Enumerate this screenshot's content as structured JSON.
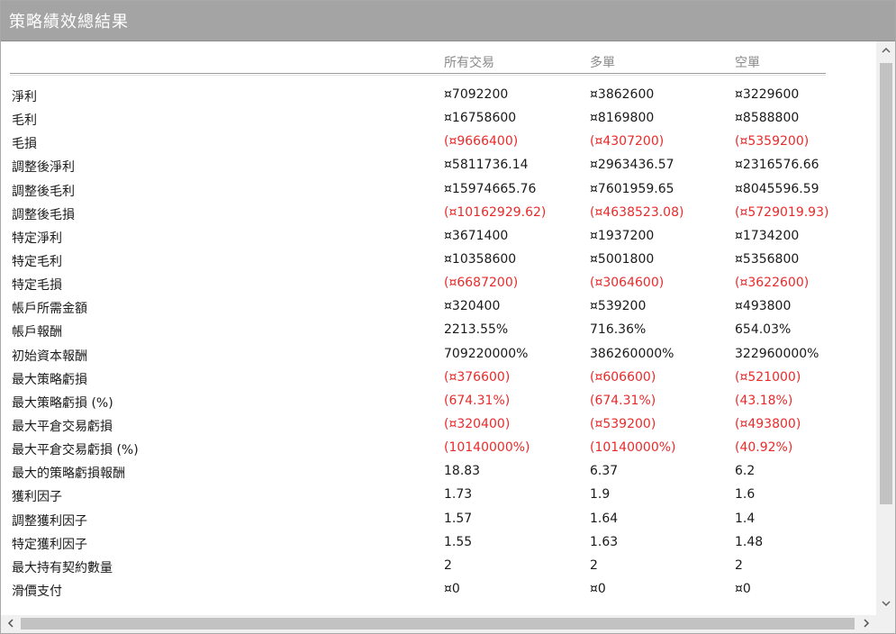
{
  "window": {
    "title": "策略績效總結果"
  },
  "table": {
    "headers": [
      "所有交易",
      "多單",
      "空單"
    ],
    "rows": [
      {
        "label": "淨利",
        "values": [
          "¤7092200",
          "¤3862600",
          "¤3229600"
        ],
        "negative": false
      },
      {
        "label": "毛利",
        "values": [
          "¤16758600",
          "¤8169800",
          "¤8588800"
        ],
        "negative": false
      },
      {
        "label": "毛損",
        "values": [
          "(¤9666400)",
          "(¤4307200)",
          "(¤5359200)"
        ],
        "negative": true
      },
      {
        "label": "調整後淨利",
        "values": [
          "¤5811736.14",
          "¤2963436.57",
          "¤2316576.66"
        ],
        "negative": false
      },
      {
        "label": "調整後毛利",
        "values": [
          "¤15974665.76",
          "¤7601959.65",
          "¤8045596.59"
        ],
        "negative": false
      },
      {
        "label": "調整後毛損",
        "values": [
          "(¤10162929.62)",
          "(¤4638523.08)",
          "(¤5729019.93)"
        ],
        "negative": true
      },
      {
        "label": "特定淨利",
        "values": [
          "¤3671400",
          "¤1937200",
          "¤1734200"
        ],
        "negative": false
      },
      {
        "label": "特定毛利",
        "values": [
          "¤10358600",
          "¤5001800",
          "¤5356800"
        ],
        "negative": false
      },
      {
        "label": "特定毛損",
        "values": [
          "(¤6687200)",
          "(¤3064600)",
          "(¤3622600)"
        ],
        "negative": true
      },
      {
        "label": "帳戶所需金額",
        "values": [
          "¤320400",
          "¤539200",
          "¤493800"
        ],
        "negative": false
      },
      {
        "label": "帳戶報酬",
        "values": [
          "2213.55%",
          "716.36%",
          "654.03%"
        ],
        "negative": false
      },
      {
        "label": "初始資本報酬",
        "values": [
          "709220000%",
          "386260000%",
          "322960000%"
        ],
        "negative": false
      },
      {
        "label": "最大策略虧損",
        "values": [
          "(¤376600)",
          "(¤606600)",
          "(¤521000)"
        ],
        "negative": true
      },
      {
        "label": "最大策略虧損 (%)",
        "values": [
          "(674.31%)",
          "(674.31%)",
          "(43.18%)"
        ],
        "negative": true
      },
      {
        "label": "最大平倉交易虧損",
        "values": [
          "(¤320400)",
          "(¤539200)",
          "(¤493800)"
        ],
        "negative": true
      },
      {
        "label": "最大平倉交易虧損 (%)",
        "values": [
          "(10140000%)",
          "(10140000%)",
          "(40.92%)"
        ],
        "negative": true
      },
      {
        "label": "最大的策略虧損報酬",
        "values": [
          "18.83",
          "6.37",
          "6.2"
        ],
        "negative": false
      },
      {
        "label": "獲利因子",
        "values": [
          "1.73",
          "1.9",
          "1.6"
        ],
        "negative": false
      },
      {
        "label": "調整獲利因子",
        "values": [
          "1.57",
          "1.64",
          "1.4"
        ],
        "negative": false
      },
      {
        "label": "特定獲利因子",
        "values": [
          "1.55",
          "1.63",
          "1.48"
        ],
        "negative": false
      },
      {
        "label": "最大持有契約數量",
        "values": [
          "2",
          "2",
          "2"
        ],
        "negative": false
      },
      {
        "label": "滑價支付",
        "values": [
          "¤0",
          "¤0",
          "¤0"
        ],
        "negative": false
      }
    ]
  },
  "colors": {
    "titlebar": "#a4a4a4",
    "negative": "#ea2a2a",
    "header_text": "#8a8a8a"
  },
  "icons": {
    "scroll_up": "chevron-up-icon",
    "scroll_down": "chevron-down-icon",
    "scroll_left": "chevron-left-icon",
    "scroll_right": "chevron-right-icon"
  }
}
